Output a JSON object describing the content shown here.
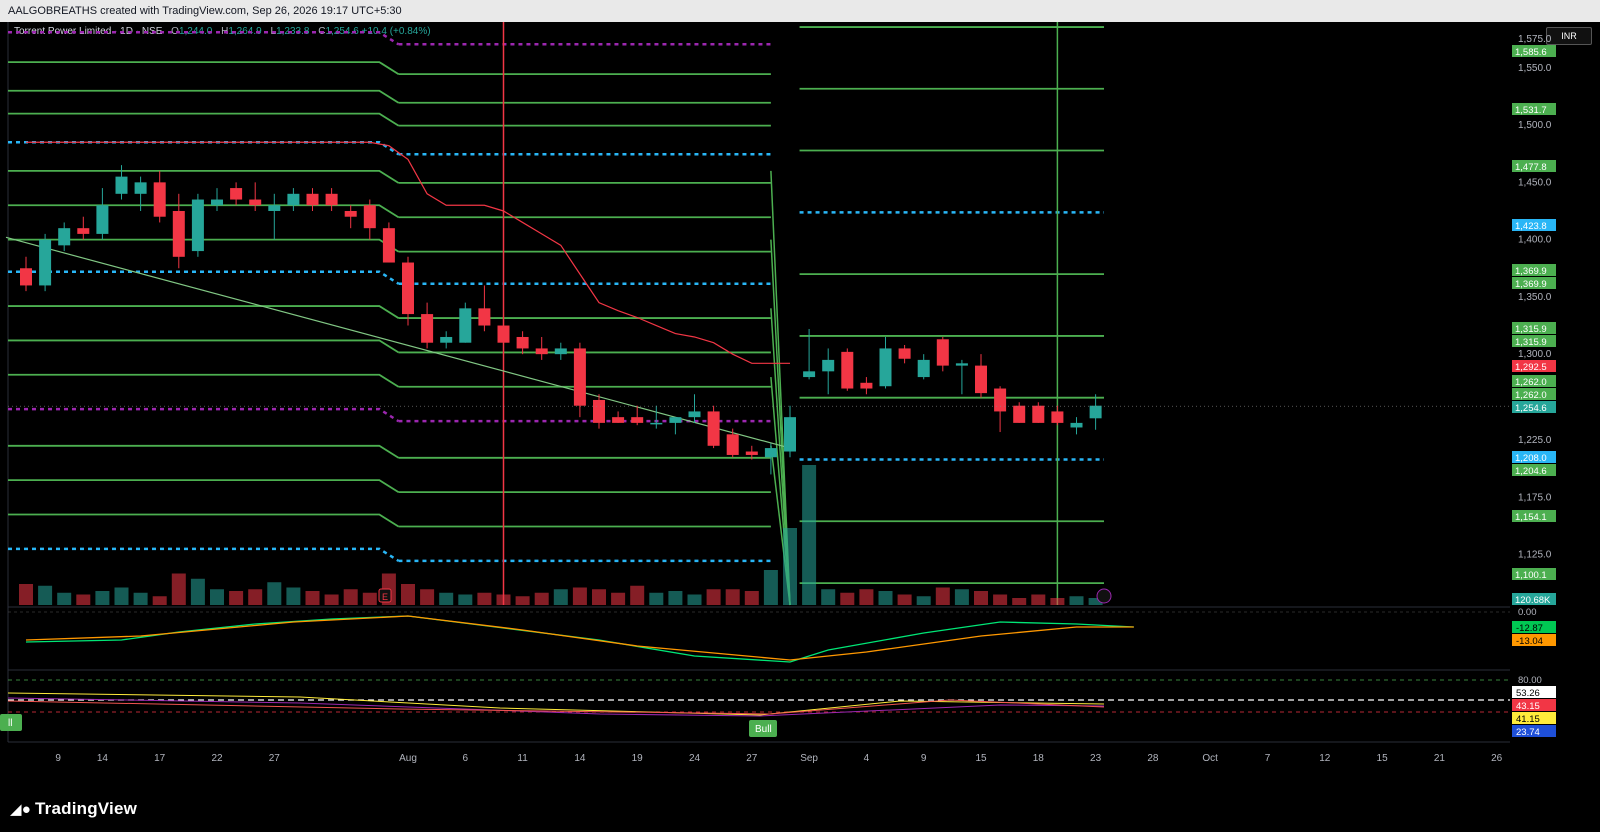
{
  "header": {
    "attribution": "AALGOBREATHS created with TradingView.com, Sep 26, 2026 19:17 UTC+5:30"
  },
  "legend": {
    "symbol": "Torrent Power Limited · 1D · NSE",
    "o_label": "O",
    "o": "1,244.0",
    "h_label": "H",
    "h": "1,264.9",
    "l_label": "L",
    "l": "1,233.8",
    "c_label": "C",
    "c": "1,254.6",
    "change": "+10.4 (+0.84%)"
  },
  "currency": "INR",
  "brand": {
    "name": "TradingView",
    "logo": "tradingview-logo-icon"
  },
  "colors": {
    "up": "#26a69a",
    "down": "#f23645",
    "level": "#4caf50",
    "cyan": "#29b6f6",
    "purple": "#9c27b0",
    "ema": "#f23645"
  },
  "chart_data": {
    "type": "candlestick",
    "y_range": [
      1081,
      1590
    ],
    "x_labels": [
      {
        "d": 1,
        "t": "9"
      },
      {
        "d": 4,
        "t": "14"
      },
      {
        "d": 7,
        "t": "17"
      },
      {
        "d": 10,
        "t": "22"
      },
      {
        "d": 13,
        "t": "27"
      },
      {
        "d": 20,
        "t": "Aug"
      },
      {
        "d": 23,
        "t": "6"
      },
      {
        "d": 26,
        "t": "11"
      },
      {
        "d": 29,
        "t": "14"
      },
      {
        "d": 32,
        "t": "19"
      },
      {
        "d": 35,
        "t": "24"
      },
      {
        "d": 38,
        "t": "27"
      },
      {
        "d": 41,
        "t": "Sep"
      },
      {
        "d": 44,
        "t": "4"
      },
      {
        "d": 47,
        "t": "9"
      },
      {
        "d": 50,
        "t": "15"
      },
      {
        "d": 53,
        "t": "18"
      },
      {
        "d": 56,
        "t": "23"
      },
      {
        "d": 59,
        "t": "28"
      },
      {
        "d": 62,
        "t": "Oct"
      },
      {
        "d": 65,
        "t": "7"
      },
      {
        "d": 68,
        "t": "12"
      },
      {
        "d": 71,
        "t": "15"
      },
      {
        "d": 74,
        "t": "21"
      },
      {
        "d": 77,
        "t": "26"
      }
    ],
    "y_ticks": [
      "1,575.0",
      "1,550.0",
      "1,500.0",
      "1,450.0",
      "1,400.0",
      "1,350.0",
      "1,300.0",
      "1,225.0",
      "1,175.0",
      "1,125.0"
    ],
    "price_badges": [
      {
        "v": "1,585.6",
        "c": "#4caf50"
      },
      {
        "v": "1,531.7",
        "c": "#4caf50"
      },
      {
        "v": "1,477.8",
        "c": "#4caf50"
      },
      {
        "v": "1,423.8",
        "c": "#29b6f6"
      },
      {
        "v": "1,369.9",
        "c": "#4caf50"
      },
      {
        "v": "1,369.9",
        "c": "#4caf50"
      },
      {
        "v": "1,315.9",
        "c": "#4caf50"
      },
      {
        "v": "1,315.9",
        "c": "#4caf50"
      },
      {
        "v": "1,292.5",
        "c": "#f23645"
      },
      {
        "v": "1,262.0",
        "c": "#4caf50"
      },
      {
        "v": "1,262.0",
        "c": "#4caf50"
      },
      {
        "v": "1,254.6",
        "c": "#26a69a"
      },
      {
        "v": "1,208.0",
        "c": "#29b6f6"
      },
      {
        "v": "1,204.6",
        "c": "#4caf50"
      },
      {
        "v": "1,154.1",
        "c": "#4caf50"
      },
      {
        "v": "1,100.1",
        "c": "#4caf50"
      },
      {
        "v": "120.68K",
        "c": "#26a69a"
      }
    ],
    "candles": [
      {
        "o": 1375,
        "h": 1385,
        "l": 1355,
        "c": 1360
      },
      {
        "o": 1360,
        "h": 1405,
        "l": 1355,
        "c": 1400
      },
      {
        "o": 1395,
        "h": 1415,
        "l": 1390,
        "c": 1410
      },
      {
        "o": 1410,
        "h": 1420,
        "l": 1400,
        "c": 1405
      },
      {
        "o": 1405,
        "h": 1445,
        "l": 1400,
        "c": 1430
      },
      {
        "o": 1440,
        "h": 1465,
        "l": 1435,
        "c": 1455
      },
      {
        "o": 1440,
        "h": 1455,
        "l": 1425,
        "c": 1450
      },
      {
        "o": 1450,
        "h": 1460,
        "l": 1415,
        "c": 1420
      },
      {
        "o": 1425,
        "h": 1440,
        "l": 1375,
        "c": 1385
      },
      {
        "o": 1390,
        "h": 1440,
        "l": 1385,
        "c": 1435
      },
      {
        "o": 1430,
        "h": 1445,
        "l": 1425,
        "c": 1435
      },
      {
        "o": 1445,
        "h": 1450,
        "l": 1430,
        "c": 1435
      },
      {
        "o": 1435,
        "h": 1450,
        "l": 1425,
        "c": 1430
      },
      {
        "o": 1425,
        "h": 1440,
        "l": 1400,
        "c": 1430
      },
      {
        "o": 1430,
        "h": 1445,
        "l": 1425,
        "c": 1440
      },
      {
        "o": 1440,
        "h": 1445,
        "l": 1425,
        "c": 1430
      },
      {
        "o": 1440,
        "h": 1445,
        "l": 1425,
        "c": 1430
      },
      {
        "o": 1425,
        "h": 1430,
        "l": 1410,
        "c": 1420
      },
      {
        "o": 1430,
        "h": 1435,
        "l": 1400,
        "c": 1410
      },
      {
        "o": 1410,
        "h": 1415,
        "l": 1380,
        "c": 1380
      },
      {
        "o": 1380,
        "h": 1385,
        "l": 1325,
        "c": 1335
      },
      {
        "o": 1335,
        "h": 1345,
        "l": 1305,
        "c": 1310
      },
      {
        "o": 1310,
        "h": 1320,
        "l": 1305,
        "c": 1315
      },
      {
        "o": 1310,
        "h": 1345,
        "l": 1310,
        "c": 1340
      },
      {
        "o": 1340,
        "h": 1360,
        "l": 1320,
        "c": 1325
      },
      {
        "o": 1325,
        "h": 1330,
        "l": 1305,
        "c": 1310
      },
      {
        "o": 1315,
        "h": 1320,
        "l": 1300,
        "c": 1305
      },
      {
        "o": 1305,
        "h": 1315,
        "l": 1295,
        "c": 1300
      },
      {
        "o": 1300,
        "h": 1310,
        "l": 1295,
        "c": 1305
      },
      {
        "o": 1305,
        "h": 1310,
        "l": 1245,
        "c": 1255
      },
      {
        "o": 1260,
        "h": 1265,
        "l": 1235,
        "c": 1240
      },
      {
        "o": 1245,
        "h": 1250,
        "l": 1240,
        "c": 1240
      },
      {
        "o": 1245,
        "h": 1255,
        "l": 1238,
        "c": 1240
      },
      {
        "o": 1240,
        "h": 1255,
        "l": 1235,
        "c": 1240
      },
      {
        "o": 1240,
        "h": 1245,
        "l": 1230,
        "c": 1245
      },
      {
        "o": 1245,
        "h": 1265,
        "l": 1240,
        "c": 1250
      },
      {
        "o": 1250,
        "h": 1255,
        "l": 1218,
        "c": 1220
      },
      {
        "o": 1230,
        "h": 1235,
        "l": 1210,
        "c": 1212
      },
      {
        "o": 1215,
        "h": 1220,
        "l": 1208,
        "c": 1212
      },
      {
        "o": 1210,
        "h": 1222,
        "l": 1195,
        "c": 1218
      },
      {
        "o": 1215,
        "h": 1255,
        "l": 1210,
        "c": 1245
      },
      {
        "o": 1280,
        "h": 1322,
        "l": 1278,
        "c": 1285
      },
      {
        "o": 1285,
        "h": 1305,
        "l": 1265,
        "c": 1295
      },
      {
        "o": 1302,
        "h": 1305,
        "l": 1268,
        "c": 1270
      },
      {
        "o": 1275,
        "h": 1280,
        "l": 1265,
        "c": 1270
      },
      {
        "o": 1272,
        "h": 1315,
        "l": 1270,
        "c": 1305
      },
      {
        "o": 1305,
        "h": 1308,
        "l": 1292,
        "c": 1296
      },
      {
        "o": 1280,
        "h": 1300,
        "l": 1278,
        "c": 1295
      },
      {
        "o": 1313,
        "h": 1315,
        "l": 1285,
        "c": 1290
      },
      {
        "o": 1290,
        "h": 1295,
        "l": 1265,
        "c": 1292
      },
      {
        "o": 1290,
        "h": 1300,
        "l": 1262,
        "c": 1266
      },
      {
        "o": 1270,
        "h": 1272,
        "l": 1232,
        "c": 1250
      },
      {
        "o": 1255,
        "h": 1258,
        "l": 1240,
        "c": 1240
      },
      {
        "o": 1255,
        "h": 1258,
        "l": 1240,
        "c": 1240
      },
      {
        "o": 1250,
        "h": 1255,
        "l": 1238,
        "c": 1240
      },
      {
        "o": 1236,
        "h": 1245,
        "l": 1230,
        "c": 1240
      },
      {
        "o": 1244,
        "h": 1265,
        "l": 1234,
        "c": 1255
      }
    ],
    "volumes": [
      0.6,
      0.55,
      0.35,
      0.3,
      0.4,
      0.5,
      0.35,
      0.25,
      0.9,
      0.75,
      0.45,
      0.4,
      0.45,
      0.65,
      0.5,
      0.4,
      0.3,
      0.45,
      0.35,
      0.9,
      0.6,
      0.45,
      0.35,
      0.3,
      0.35,
      0.3,
      0.25,
      0.35,
      0.45,
      0.5,
      0.45,
      0.35,
      0.55,
      0.35,
      0.4,
      0.3,
      0.45,
      0.45,
      0.4,
      1.0,
      2.2,
      4.0,
      0.45,
      0.35,
      0.45,
      0.4,
      0.3,
      0.25,
      0.5,
      0.45,
      0.4,
      0.3,
      0.2,
      0.3,
      0.2,
      0.25,
      0.2
    ],
    "horizontal_levels": [
      {
        "v": 1585.6,
        "color": "#4caf50",
        "dash": false,
        "from": 41
      },
      {
        "v": 1531.7,
        "color": "#4caf50",
        "dash": false,
        "from": 41
      },
      {
        "v": 1477.8,
        "color": "#4caf50",
        "dash": false,
        "from": 41
      },
      {
        "v": 1423.8,
        "color": "#29b6f6",
        "dash": true,
        "from": 41
      },
      {
        "v": 1369.9,
        "color": "#4caf50",
        "dash": false,
        "from": 41
      },
      {
        "v": 1315.9,
        "color": "#4caf50",
        "dash": false,
        "from": 41
      },
      {
        "v": 1262.0,
        "color": "#4caf50",
        "dash": false,
        "from": 41
      },
      {
        "v": 1208.0,
        "color": "#29b6f6",
        "dash": true,
        "from": 41
      },
      {
        "v": 1154.1,
        "color": "#4caf50",
        "dash": false,
        "from": 41
      },
      {
        "v": 1100.1,
        "color": "#4caf50",
        "dash": false,
        "from": 41
      }
    ],
    "old_levels": [
      {
        "v": 1581,
        "color": "#9c27b0",
        "dash": true
      },
      {
        "v": 1555,
        "color": "#4caf50",
        "dash": false
      },
      {
        "v": 1530,
        "color": "#4caf50",
        "dash": false
      },
      {
        "v": 1510,
        "color": "#4caf50",
        "dash": false
      },
      {
        "v": 1485,
        "color": "#29b6f6",
        "dash": true
      },
      {
        "v": 1460,
        "color": "#4caf50",
        "dash": false
      },
      {
        "v": 1430,
        "color": "#4caf50",
        "dash": false
      },
      {
        "v": 1400,
        "color": "#4caf50",
        "dash": false
      },
      {
        "v": 1372,
        "color": "#29b6f6",
        "dash": true
      },
      {
        "v": 1342,
        "color": "#4caf50",
        "dash": false
      },
      {
        "v": 1312,
        "color": "#4caf50",
        "dash": false
      },
      {
        "v": 1282,
        "color": "#4caf50",
        "dash": false
      },
      {
        "v": 1252,
        "color": "#9c27b0",
        "dash": true
      },
      {
        "v": 1220,
        "color": "#4caf50",
        "dash": false
      },
      {
        "v": 1190,
        "color": "#4caf50",
        "dash": false
      },
      {
        "v": 1160,
        "color": "#4caf50",
        "dash": false
      },
      {
        "v": 1130,
        "color": "#29b6f6",
        "dash": true
      }
    ],
    "ema": [
      1485,
      1485,
      1485,
      1485,
      1485,
      1485,
      1485,
      1485,
      1485,
      1485,
      1485,
      1485,
      1485,
      1485,
      1485,
      1485,
      1485,
      1485,
      1485,
      1482,
      1470,
      1440,
      1430,
      1430,
      1430,
      1425,
      1415,
      1405,
      1395,
      1370,
      1345,
      1338,
      1332,
      1325,
      1318,
      1315,
      1310,
      1300,
      1292,
      1292,
      1292
    ],
    "trendline": {
      "from": [
        0,
        1402
      ],
      "to": [
        40,
        1218
      ]
    },
    "vlines": [
      {
        "d": 25,
        "color": "#f23645"
      },
      {
        "d": 54,
        "color": "#4caf50"
      }
    ],
    "macd": {
      "macd": "-12.87",
      "signal": "-13.04",
      "zero": "0.00"
    },
    "rsi": {
      "upper": "80.00",
      "values": [
        "53.26",
        "43.15",
        "41.15",
        "23.74"
      ]
    },
    "bull_label": "Bull",
    "bull_label_left": "ll",
    "event_marker": "E"
  }
}
